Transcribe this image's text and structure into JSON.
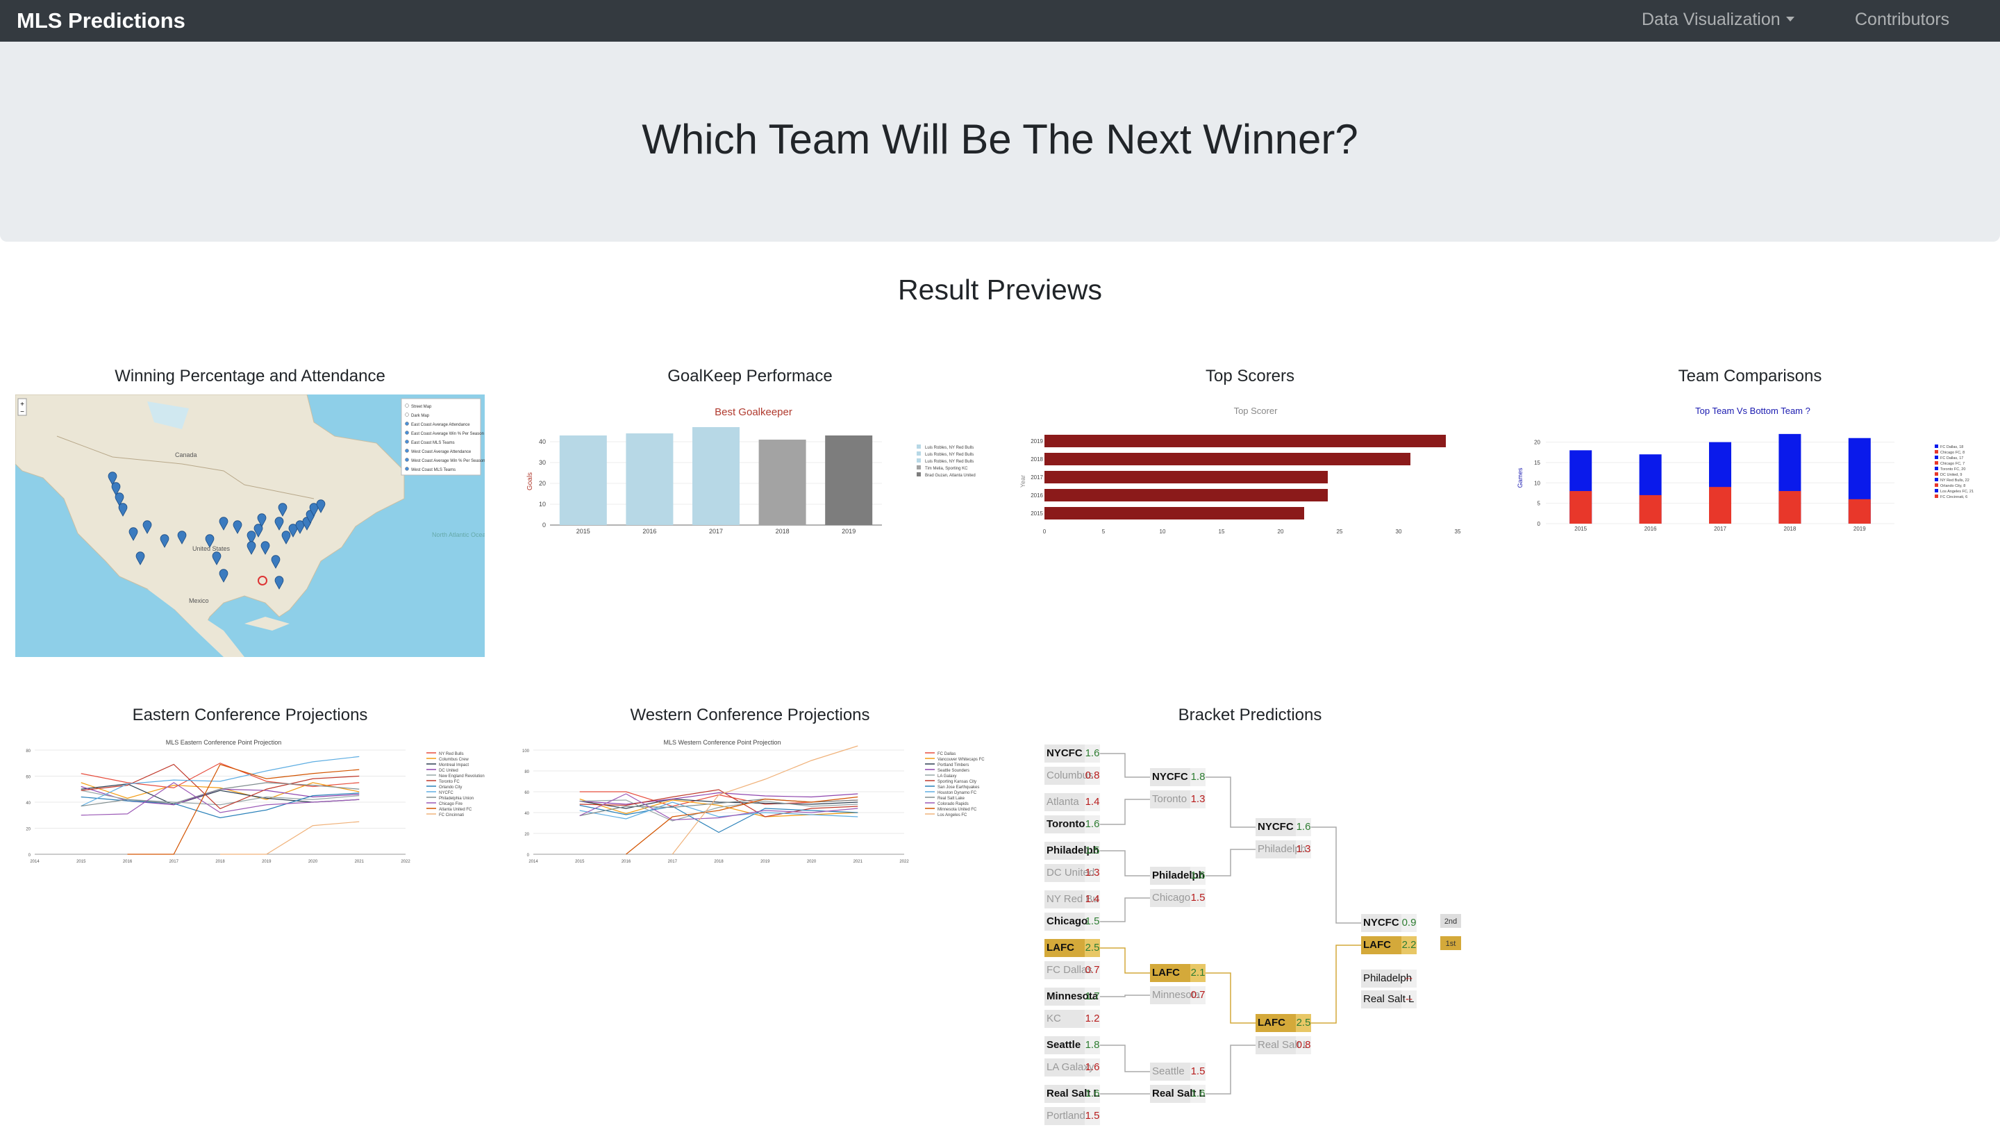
{
  "nav": {
    "brand": "MLS Predictions",
    "data_viz": "Data Visualization",
    "contributors": "Contributors"
  },
  "hero": {
    "title": "Which Team Will Be The Next Winner?"
  },
  "section": {
    "title": "Result Previews"
  },
  "cards": {
    "map": "Winning Percentage and Attendance",
    "goalkeep": "GoalKeep Performace",
    "scorers": "Top Scorers",
    "compare": "Team Comparisons",
    "east": "Eastern Conference Projections",
    "west": "Western Conference Projections",
    "bracket": "Bracket Predictions"
  },
  "map_layers": [
    "Street Map",
    "Dark Map",
    "East Coast Average Attendance",
    "East Coast Average Win % Per Season",
    "East Coast MLS Teams",
    "West Coast Average Attendance",
    "West Coast Average Win % Per Season",
    "West Coast MLS Teams"
  ],
  "map_labels": [
    "Canada",
    "United States",
    "Mexico",
    "North Atlantic Ocean"
  ],
  "colors": {
    "navbar": "#343a40",
    "jumbotron": "#e9ecef",
    "bar_dark": "#8b1a1a",
    "blue": "#0a1aeb",
    "red": "#e8372a",
    "gold": "#d4a93a"
  },
  "chart_data": [
    {
      "type": "bar",
      "title": "Best Goalkeeper",
      "ylabel": "Goals",
      "categories": [
        "2015",
        "2016",
        "2017",
        "2018",
        "2019"
      ],
      "values": [
        43,
        44,
        47,
        41,
        43
      ],
      "ylim": [
        0,
        50
      ],
      "yticks": [
        "0",
        "10",
        "20",
        "30",
        "40"
      ],
      "legend": [
        "Luis Robles, NY Red Bulls",
        "Luis Robles, NY Red Bulls",
        "Luis Robles, NY Red Bulls",
        "Tim Melia, Sporting KC",
        "Brad Guzan, Atlanta United"
      ]
    },
    {
      "type": "bar",
      "title": "Top Scorer",
      "ylabel": "Year",
      "orientation": "horizontal",
      "categories": [
        "2019",
        "2018",
        "2017",
        "2016",
        "2015"
      ],
      "values": [
        34,
        31,
        24,
        24,
        22
      ],
      "xlim": [
        0,
        35
      ],
      "xticks": [
        "0",
        "5",
        "10",
        "15",
        "20",
        "25",
        "30",
        "35"
      ]
    },
    {
      "type": "bar",
      "title": "Top Team Vs Bottom Team ?",
      "ylabel": "Games",
      "stacked": true,
      "categories": [
        "2015",
        "2016",
        "2017",
        "2018",
        "2019"
      ],
      "series": [
        {
          "name": "bottom",
          "values": [
            8,
            7,
            9,
            8,
            6
          ]
        },
        {
          "name": "top",
          "values": [
            18,
            17,
            20,
            22,
            21
          ]
        }
      ],
      "ylim": [
        0,
        23
      ],
      "yticks": [
        "0",
        "5",
        "10",
        "15",
        "20"
      ],
      "legend": [
        "FC Dallas, 18",
        "Chicago FC, 8",
        "FC Dallas, 17",
        "Chicago FC, 7",
        "Toronto FC, 20",
        "DC United, 9",
        "NY Red Bulls, 22",
        "Orlando City, 8",
        "Los Angeles FC, 21",
        "FC Cincinnati, 6"
      ]
    },
    {
      "type": "line",
      "title": "MLS Eastern Conference Point Projection",
      "x": [
        "2014",
        "2015",
        "2016",
        "2017",
        "2018",
        "2019",
        "2020",
        "2021",
        "2022"
      ],
      "yticks": [
        "0",
        "20",
        "40",
        "60",
        "80"
      ],
      "series": [
        {
          "name": "NY Red Bulls",
          "values": [
            null,
            62,
            55,
            51,
            70,
            56,
            52,
            55
          ]
        },
        {
          "name": "Columbus Crew",
          "values": [
            null,
            55,
            43,
            53,
            51,
            42,
            55,
            48
          ]
        },
        {
          "name": "Montreal Impact",
          "values": [
            null,
            50,
            54,
            38,
            49,
            43,
            40,
            42
          ]
        },
        {
          "name": "DC United",
          "values": [
            null,
            52,
            41,
            38,
            50,
            49,
            44,
            46
          ]
        },
        {
          "name": "New England Revolution",
          "values": [
            null,
            49,
            42,
            40,
            38,
            44,
            42,
            45
          ]
        },
        {
          "name": "Toronto FC",
          "values": [
            null,
            49,
            53,
            69,
            35,
            50,
            58,
            60
          ]
        },
        {
          "name": "Orlando City",
          "values": [
            null,
            44,
            41,
            39,
            28,
            34,
            45,
            47
          ]
        },
        {
          "name": "NYCFC",
          "values": [
            null,
            37,
            54,
            57,
            56,
            64,
            71,
            75
          ]
        },
        {
          "name": "Philadelphia Union",
          "values": [
            null,
            37,
            42,
            39,
            50,
            55,
            53,
            50
          ]
        },
        {
          "name": "Chicago Fire",
          "values": [
            null,
            30,
            31,
            55,
            32,
            38,
            40,
            42
          ]
        },
        {
          "name": "Atlanta United FC",
          "values": [
            null,
            null,
            0,
            0,
            69,
            58,
            62,
            65
          ]
        },
        {
          "name": "FC Cincinnati",
          "values": [
            null,
            null,
            null,
            null,
            0,
            0,
            22,
            25
          ]
        }
      ]
    },
    {
      "type": "line",
      "title": "MLS Western Conference Point Projection",
      "x": [
        "2014",
        "2015",
        "2016",
        "2017",
        "2018",
        "2019",
        "2020",
        "2021",
        "2022"
      ],
      "yticks": [
        "0",
        "20",
        "40",
        "60",
        "80",
        "100"
      ],
      "series": [
        {
          "name": "FC Dallas",
          "values": [
            null,
            60,
            60,
            46,
            57,
            48,
            50,
            52
          ]
        },
        {
          "name": "Vancouver Whitecaps FC",
          "values": [
            null,
            53,
            39,
            52,
            47,
            36,
            38,
            40
          ]
        },
        {
          "name": "Portland Timbers",
          "values": [
            null,
            51,
            44,
            53,
            50,
            49,
            48,
            50
          ]
        },
        {
          "name": "Seattle Sounders",
          "values": [
            null,
            51,
            48,
            53,
            59,
            56,
            55,
            58
          ]
        },
        {
          "name": "LA Galaxy",
          "values": [
            null,
            51,
            52,
            32,
            45,
            51,
            46,
            48
          ]
        },
        {
          "name": "Sporting Kansas City",
          "values": [
            null,
            48,
            47,
            55,
            62,
            36,
            44,
            46
          ]
        },
        {
          "name": "San Jose Earthquakes",
          "values": [
            null,
            47,
            38,
            46,
            21,
            44,
            42,
            40
          ]
        },
        {
          "name": "Houston Dynamo FC",
          "values": [
            null,
            42,
            34,
            50,
            36,
            40,
            38,
            36
          ]
        },
        {
          "name": "Real Salt Lake",
          "values": [
            null,
            37,
            46,
            45,
            49,
            53,
            50,
            52
          ]
        },
        {
          "name": "Colorado Rapids",
          "values": [
            null,
            37,
            58,
            33,
            35,
            42,
            40,
            44
          ]
        },
        {
          "name": "Minnesota United FC",
          "values": [
            null,
            null,
            0,
            36,
            42,
            53,
            50,
            55
          ]
        },
        {
          "name": "Los Angeles FC",
          "values": [
            null,
            null,
            null,
            0,
            57,
            72,
            90,
            104
          ]
        }
      ]
    }
  ],
  "bracket": {
    "r1": [
      {
        "team": "NYCFC",
        "score": "1.6",
        "win": true
      },
      {
        "team": "Columbus",
        "score": "0.8",
        "win": false
      },
      {
        "team": "Atlanta",
        "score": "1.4",
        "win": false
      },
      {
        "team": "Toronto",
        "score": "1.6",
        "win": true
      },
      {
        "team": "Philadelph",
        "score": "1.5",
        "win": true
      },
      {
        "team": "DC United",
        "score": "1.3",
        "win": false
      },
      {
        "team": "NY Red Bu",
        "score": "1.4",
        "win": false
      },
      {
        "team": "Chicago",
        "score": "1.5",
        "win": true
      },
      {
        "team": "LAFC",
        "score": "2.5",
        "win": true,
        "gold": true
      },
      {
        "team": "FC Dallas",
        "score": "0.7",
        "win": false
      },
      {
        "team": "Minnesota",
        "score": "1.7",
        "win": true
      },
      {
        "team": "KC",
        "score": "1.2",
        "win": false
      },
      {
        "team": "Seattle",
        "score": "1.8",
        "win": true
      },
      {
        "team": "LA Galaxy",
        "score": "1.6",
        "win": false
      },
      {
        "team": "Real Salt L",
        "score": "1.6",
        "win": true
      },
      {
        "team": "Portland",
        "score": "1.5",
        "win": false
      }
    ],
    "r2": [
      {
        "team": "NYCFC",
        "score": "1.8",
        "win": true
      },
      {
        "team": "Toronto",
        "score": "1.3",
        "win": false
      },
      {
        "team": "Philadelph",
        "score": "1.6",
        "win": true
      },
      {
        "team": "Chicago",
        "score": "1.5",
        "win": false
      },
      {
        "team": "LAFC",
        "score": "2.1",
        "win": true,
        "gold": true
      },
      {
        "team": "Minnesota",
        "score": "0.7",
        "win": false
      },
      {
        "team": "Seattle",
        "score": "1.5",
        "win": false
      },
      {
        "team": "Real Salt L",
        "score": "1.6",
        "win": true
      }
    ],
    "r3": [
      {
        "team": "NYCFC",
        "score": "1.6",
        "win": true
      },
      {
        "team": "Philadelph",
        "score": "1.3",
        "win": false
      },
      {
        "team": "LAFC",
        "score": "2.5",
        "win": true,
        "gold": true
      },
      {
        "team": "Real Salt L",
        "score": "0.8",
        "win": false
      }
    ],
    "final": [
      {
        "team": "NYCFC",
        "score": "0.9",
        "win": true,
        "place": "2nd"
      },
      {
        "team": "LAFC",
        "score": "2.2",
        "win": true,
        "gold": true,
        "place": "1st"
      }
    ],
    "third": [
      {
        "team": "Philadelph",
        "score": "--"
      },
      {
        "team": "Real Salt L",
        "score": "--"
      }
    ]
  }
}
